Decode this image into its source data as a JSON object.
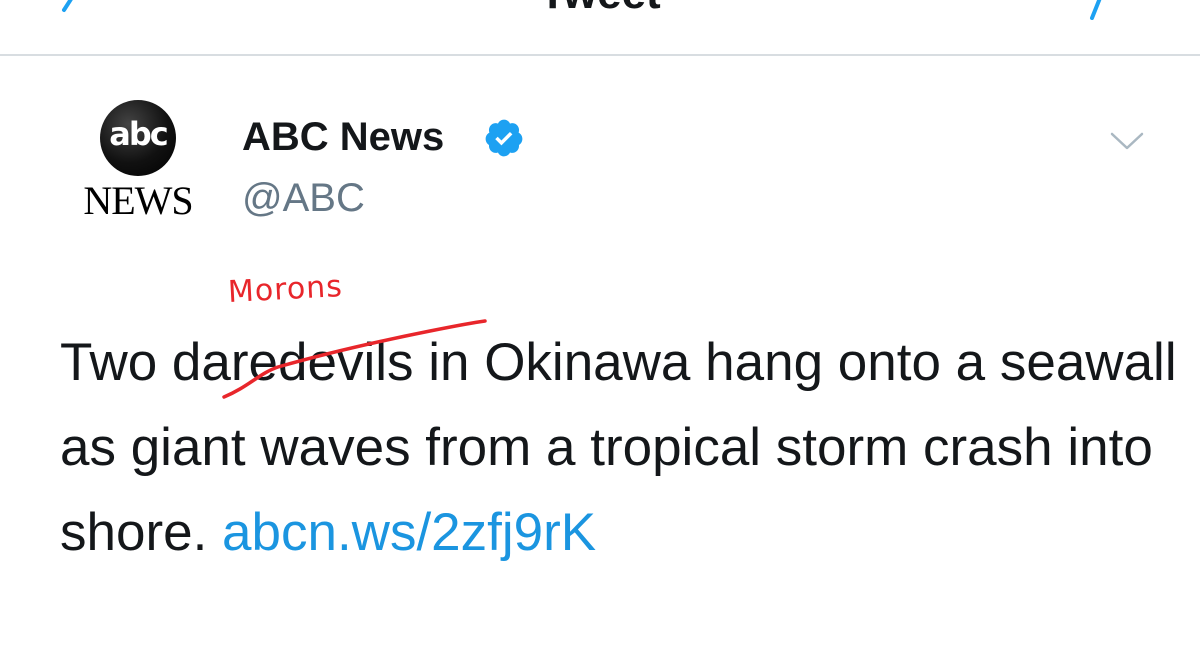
{
  "nav": {
    "title": "Tweet"
  },
  "account": {
    "logo": {
      "abc": "abc",
      "news": "NEWS"
    },
    "name": "ABC News",
    "handle": "@ABC",
    "verified": true
  },
  "tweet": {
    "text": "Two daredevils in Okinawa hang onto a seawall as giant waves from a tropical storm crash into shore. ",
    "link": "abcn.ws/2zfj9rK"
  },
  "annotation": {
    "word": "Morons",
    "color": "#e8262b"
  },
  "colors": {
    "link": "#1b95e0",
    "accent": "#1da1f2",
    "handle": "#657786",
    "divider": "#d8dde1"
  },
  "icons": {
    "back": "back-arrow-icon",
    "compose": "compose-icon",
    "verified": "verified-badge-icon",
    "menu": "chevron-down-icon"
  }
}
